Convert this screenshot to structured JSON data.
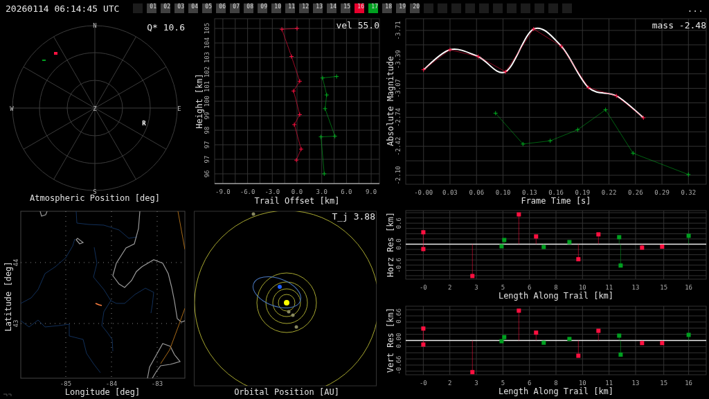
{
  "top_bar": {
    "timestamp": "20260114 06:14:45 UTC",
    "menu": "...",
    "frames": [
      {
        "kind": "empty"
      },
      {
        "kind": "numbered",
        "label": "01",
        "color": "#404040"
      },
      {
        "kind": "numbered",
        "label": "02",
        "color": "#404040"
      },
      {
        "kind": "numbered",
        "label": "03",
        "color": "#404040"
      },
      {
        "kind": "numbered",
        "label": "04",
        "color": "#404040"
      },
      {
        "kind": "numbered",
        "label": "05",
        "color": "#404040"
      },
      {
        "kind": "numbered",
        "label": "06",
        "color": "#404040"
      },
      {
        "kind": "numbered",
        "label": "07",
        "color": "#404040"
      },
      {
        "kind": "numbered",
        "label": "08",
        "color": "#404040"
      },
      {
        "kind": "numbered",
        "label": "09",
        "color": "#404040"
      },
      {
        "kind": "numbered",
        "label": "10",
        "color": "#404040"
      },
      {
        "kind": "numbered",
        "label": "11",
        "color": "#404040"
      },
      {
        "kind": "numbered",
        "label": "12",
        "color": "#404040"
      },
      {
        "kind": "numbered",
        "label": "13",
        "color": "#404040"
      },
      {
        "kind": "numbered",
        "label": "14",
        "color": "#404040"
      },
      {
        "kind": "numbered",
        "label": "15",
        "color": "#404040"
      },
      {
        "kind": "numbered",
        "label": "16",
        "color": "#e8002d"
      },
      {
        "kind": "numbered",
        "label": "17",
        "color": "#00a020"
      },
      {
        "kind": "numbered",
        "label": "18",
        "color": "#404040"
      },
      {
        "kind": "numbered",
        "label": "19",
        "color": "#404040"
      },
      {
        "kind": "numbered",
        "label": "20",
        "color": "#404040"
      },
      {
        "kind": "empty"
      },
      {
        "kind": "empty"
      },
      {
        "kind": "empty"
      },
      {
        "kind": "empty"
      },
      {
        "kind": "empty"
      },
      {
        "kind": "empty"
      },
      {
        "kind": "empty"
      },
      {
        "kind": "empty"
      },
      {
        "kind": "empty"
      },
      {
        "kind": "empty"
      },
      {
        "kind": "empty"
      }
    ]
  },
  "atmospheric_position": {
    "label": "Q* 10.6",
    "title": "Atmospheric Position [deg]",
    "north": "N",
    "east": "E",
    "south": "S",
    "west": "W",
    "zenith": "Z",
    "station": "R"
  },
  "trail_offset": {
    "label": "vel 55.0",
    "chart_data": {
      "type": "line",
      "grid": true,
      "xlabel": "Trail Offset [km]",
      "ylabel": "Height [km]",
      "xlim": [
        -10,
        10
      ],
      "ylim": [
        95.14,
        105.13
      ],
      "xticks": [
        {
          "value": -9,
          "label": "-9.0"
        },
        {
          "value": -6,
          "label": "-6.0"
        },
        {
          "value": -3,
          "label": "-3.0"
        },
        {
          "value": 0,
          "label": "0.0"
        },
        {
          "value": 3,
          "label": "3.0"
        },
        {
          "value": 6,
          "label": "6.0"
        },
        {
          "value": 9,
          "label": "9.0"
        }
      ],
      "yticks": [
        {
          "value": 95.73,
          "label": "96"
        },
        {
          "value": 96.61,
          "label": "97"
        },
        {
          "value": 97.49,
          "label": "97"
        },
        {
          "value": 98.37,
          "label": "98"
        },
        {
          "value": 99.25,
          "label": "99"
        },
        {
          "value": 100.13,
          "label": "100"
        },
        {
          "value": 101.02,
          "label": "101"
        },
        {
          "value": 101.9,
          "label": "102"
        },
        {
          "value": 102.78,
          "label": "103"
        },
        {
          "value": 103.66,
          "label": "104"
        },
        {
          "value": 104.54,
          "label": "105"
        }
      ],
      "series": [
        {
          "marker": "plus",
          "color": "#ff1040",
          "x": [
            0,
            -1.84,
            -0.67,
            0.33,
            -0.42,
            0.33,
            -0.33,
            0.5,
            -0.08
          ],
          "values": [
            104.54,
            104.49,
            102.84,
            101.34,
            100.75,
            99.32,
            98.71,
            97.23,
            96.56
          ]
        },
        {
          "marker": "plus",
          "color": "#00b020",
          "x": [
            4.8,
            3.1,
            3.6,
            3.4,
            4.6,
            2.9,
            3.3
          ],
          "values": [
            101.63,
            101.54,
            100.51,
            99.68,
            98.01,
            97.97,
            95.73
          ]
        }
      ]
    }
  },
  "magnitude": {
    "label": "mass -2.48",
    "chart_data": {
      "type": "line",
      "grid": true,
      "xlabel": "Frame Time [s]",
      "ylabel": "Absolute Magnitude",
      "xlim": [
        -0.0215,
        0.3415
      ],
      "ylim": [
        -2.0,
        -3.84
      ],
      "xticks": [
        {
          "value": 0,
          "label": "-0.00"
        },
        {
          "value": 0.032,
          "label": "0.03"
        },
        {
          "value": 0.064,
          "label": "0.06"
        },
        {
          "value": 0.096,
          "label": "0.10"
        },
        {
          "value": 0.128,
          "label": "0.13"
        },
        {
          "value": 0.16,
          "label": "0.16"
        },
        {
          "value": 0.192,
          "label": "0.19"
        },
        {
          "value": 0.224,
          "label": "0.22"
        },
        {
          "value": 0.256,
          "label": "0.26"
        },
        {
          "value": 0.288,
          "label": "0.29"
        },
        {
          "value": 0.32,
          "label": "0.32"
        }
      ],
      "yticks": [
        {
          "value": -3.71,
          "label": "-3.71"
        },
        {
          "value": -3.388,
          "label": "-3.39"
        },
        {
          "value": -3.066,
          "label": "-3.07"
        },
        {
          "value": -2.744,
          "label": "-2.74"
        },
        {
          "value": -2.422,
          "label": "-2.42"
        },
        {
          "value": -2.1,
          "label": "-2.10"
        }
      ],
      "series": [
        {
          "marker": "none",
          "color": "#ffffff",
          "x": [
            0,
            0.032,
            0.0661,
            0.099,
            0.133,
            0.1664,
            0.1993,
            0.233,
            0.2656
          ],
          "values": [
            -3.273,
            -3.495,
            -3.419,
            -3.25,
            -3.725,
            -3.534,
            -3.074,
            -2.982,
            -2.739
          ]
        },
        {
          "marker": "plus",
          "color": "#ff1040",
          "x": [
            0,
            0.032,
            0.0661,
            0.099,
            0.133,
            0.1664,
            0.1993,
            0.233,
            0.2656
          ],
          "values": [
            -3.273,
            -3.495,
            -3.419,
            -3.25,
            -3.725,
            -3.534,
            -3.074,
            -2.982,
            -2.739
          ]
        },
        {
          "marker": "plus",
          "color": "#00b020",
          "x": [
            0.087,
            0.1201,
            0.153,
            0.1862,
            0.2199,
            0.2531,
            0.32
          ],
          "values": [
            -2.79,
            -2.447,
            -2.483,
            -2.606,
            -2.828,
            -2.345,
            -2.108
          ]
        }
      ]
    }
  },
  "map": {
    "xlabel": "Longitude [deg]",
    "ylabel": "Latitude [deg]",
    "xticks": [
      "-85",
      "-84",
      "-83"
    ],
    "yticks": [
      "44",
      "43"
    ]
  },
  "orbit": {
    "label": "T_j 3.88",
    "title": "Orbital Position [AU]"
  },
  "horizontal_residuals": {
    "chart_data": {
      "type": "scatter",
      "grid": true,
      "xlabel": "Length Along Trail [km]",
      "ylabel": "Horz Res [km]",
      "xlim": [
        -1.06,
        17.06
      ],
      "ylim": [
        -1.0,
        0.96
      ],
      "xticks": [
        {
          "value": 0,
          "label": "-0"
        },
        {
          "value": 1.6,
          "label": "2"
        },
        {
          "value": 3.2,
          "label": "3"
        },
        {
          "value": 4.8,
          "label": "5"
        },
        {
          "value": 6.4,
          "label": "6"
        },
        {
          "value": 8,
          "label": "8"
        },
        {
          "value": 9.6,
          "label": "10"
        },
        {
          "value": 11.2,
          "label": "11"
        },
        {
          "value": 12.8,
          "label": "13"
        },
        {
          "value": 14.5,
          "label": "15"
        },
        {
          "value": 16,
          "label": "16"
        }
      ],
      "yticks": [
        {
          "value": -0.6,
          "label": "-0.6"
        },
        {
          "value": 0,
          "label": "0.0"
        },
        {
          "value": 0.6,
          "label": "0.6"
        }
      ],
      "series": [
        {
          "marker": "square",
          "color": "#ff1040",
          "x": [
            0,
            0,
            2.96,
            5.76,
            6.8,
            9.35,
            10.56,
            13.19,
            14.4
          ],
          "values": [
            0.34,
            -0.14,
            -0.91,
            0.85,
            0.22,
            -0.43,
            0.28,
            -0.1,
            -0.07
          ]
        },
        {
          "marker": "square",
          "color": "#00a020",
          "x": [
            4.72,
            4.88,
            7.26,
            8.81,
            11.81,
            11.9,
            16.0
          ],
          "values": [
            -0.06,
            0.12,
            -0.08,
            0.06,
            0.2,
            -0.61,
            0.24
          ]
        }
      ]
    }
  },
  "vertical_residuals": {
    "chart_data": {
      "type": "scatter",
      "grid": true,
      "xlabel": "Length Along Trail [km]",
      "ylabel": "Vert Res [km]",
      "xlim": [
        -1.06,
        17.06
      ],
      "ylim": [
        -0.92,
        0.92
      ],
      "xticks": [
        {
          "value": 0,
          "label": "-0"
        },
        {
          "value": 1.6,
          "label": "2"
        },
        {
          "value": 3.2,
          "label": "3"
        },
        {
          "value": 4.8,
          "label": "5"
        },
        {
          "value": 6.4,
          "label": "6"
        },
        {
          "value": 8,
          "label": "8"
        },
        {
          "value": 9.6,
          "label": "10"
        },
        {
          "value": 11.2,
          "label": "11"
        },
        {
          "value": 12.8,
          "label": "13"
        },
        {
          "value": 14.5,
          "label": "15"
        },
        {
          "value": 16,
          "label": "16"
        }
      ],
      "yticks": [
        {
          "value": -0.66,
          "label": "-0.66"
        },
        {
          "value": 0,
          "label": "0.00"
        },
        {
          "value": 0.66,
          "label": "0.66"
        }
      ],
      "series": [
        {
          "marker": "square",
          "color": "#ff1040",
          "x": [
            0,
            0,
            2.96,
            5.76,
            6.8,
            9.35,
            10.56,
            13.19,
            14.4
          ],
          "values": [
            0.32,
            -0.11,
            -0.85,
            0.8,
            0.21,
            -0.41,
            0.26,
            -0.07,
            -0.07
          ]
        },
        {
          "marker": "square",
          "color": "#00a020",
          "x": [
            4.72,
            4.88,
            7.26,
            8.81,
            11.81,
            11.9,
            16.0
          ],
          "values": [
            -0.02,
            0.09,
            -0.06,
            0.04,
            0.13,
            -0.38,
            0.15
          ]
        }
      ]
    }
  }
}
